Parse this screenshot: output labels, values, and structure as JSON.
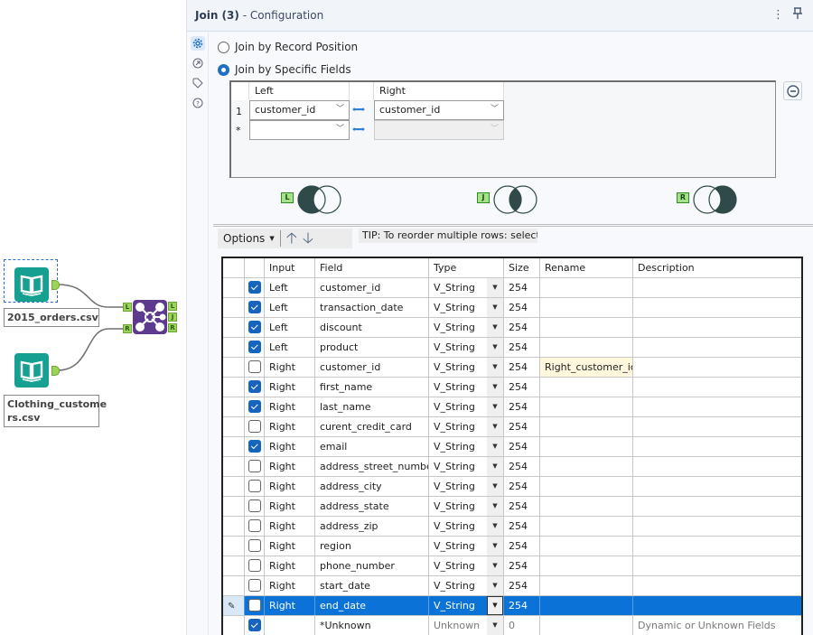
{
  "canvas": {
    "tools": [
      {
        "name": "2015_orders.csv",
        "label_lines": [
          "2015_orders.csv"
        ]
      },
      {
        "name": "Clothing_customers.csv",
        "label_lines": [
          "Clothing_custome",
          "rs.csv"
        ]
      }
    ],
    "join_tool": {
      "input_anchors": [
        "L",
        "R"
      ],
      "output_anchors": [
        "L",
        "J",
        "R"
      ]
    }
  },
  "panel": {
    "title_bold": "Join (3)",
    "title_rest": " - Configuration",
    "menu_icon": "⋮",
    "pin_icon": "pin-icon",
    "rail": [
      "gear-icon",
      "annotation-icon",
      "tag-icon",
      "help-icon"
    ]
  },
  "join_mode": {
    "options": [
      {
        "label": "Join by Record Position",
        "selected": false
      },
      {
        "label": "Join by Specific Fields",
        "selected": true
      }
    ]
  },
  "join_fields": {
    "headers": {
      "left": "Left",
      "right": "Right"
    },
    "rows": [
      {
        "index": "1",
        "left": "customer_id",
        "right": "customer_id"
      },
      {
        "index": "*",
        "left": "",
        "right": ""
      }
    ]
  },
  "venn": [
    {
      "anchor": "L",
      "name": "left-unjoined"
    },
    {
      "anchor": "J",
      "name": "inner-join"
    },
    {
      "anchor": "R",
      "name": "right-unjoined"
    }
  ],
  "toolbar": {
    "options_label": "Options",
    "tip": "TIP: To reorder multiple rows: select, right-click and drag."
  },
  "fields_table": {
    "headers": {
      "input": "Input",
      "field": "Field",
      "type": "Type",
      "size": "Size",
      "rename": "Rename",
      "description": "Description"
    },
    "rows": [
      {
        "checked": true,
        "input": "Left",
        "field": "customer_id",
        "type": "V_String",
        "size": "254",
        "rename": "",
        "description": ""
      },
      {
        "checked": true,
        "input": "Left",
        "field": "transaction_date",
        "type": "V_String",
        "size": "254",
        "rename": "",
        "description": ""
      },
      {
        "checked": true,
        "input": "Left",
        "field": "discount",
        "type": "V_String",
        "size": "254",
        "rename": "",
        "description": ""
      },
      {
        "checked": true,
        "input": "Left",
        "field": "product",
        "type": "V_String",
        "size": "254",
        "rename": "",
        "description": ""
      },
      {
        "checked": false,
        "input": "Right",
        "field": "customer_id",
        "type": "V_String",
        "size": "254",
        "rename": "Right_customer_id",
        "description": ""
      },
      {
        "checked": true,
        "input": "Right",
        "field": "first_name",
        "type": "V_String",
        "size": "254",
        "rename": "",
        "description": ""
      },
      {
        "checked": true,
        "input": "Right",
        "field": "last_name",
        "type": "V_String",
        "size": "254",
        "rename": "",
        "description": ""
      },
      {
        "checked": false,
        "input": "Right",
        "field": "curent_credit_card",
        "type": "V_String",
        "size": "254",
        "rename": "",
        "description": ""
      },
      {
        "checked": true,
        "input": "Right",
        "field": "email",
        "type": "V_String",
        "size": "254",
        "rename": "",
        "description": ""
      },
      {
        "checked": false,
        "input": "Right",
        "field": "address_street_number",
        "type": "V_String",
        "size": "254",
        "rename": "",
        "description": ""
      },
      {
        "checked": false,
        "input": "Right",
        "field": "address_city",
        "type": "V_String",
        "size": "254",
        "rename": "",
        "description": ""
      },
      {
        "checked": false,
        "input": "Right",
        "field": "address_state",
        "type": "V_String",
        "size": "254",
        "rename": "",
        "description": ""
      },
      {
        "checked": false,
        "input": "Right",
        "field": "address_zip",
        "type": "V_String",
        "size": "254",
        "rename": "",
        "description": ""
      },
      {
        "checked": false,
        "input": "Right",
        "field": "region",
        "type": "V_String",
        "size": "254",
        "rename": "",
        "description": ""
      },
      {
        "checked": false,
        "input": "Right",
        "field": "phone_number",
        "type": "V_String",
        "size": "254",
        "rename": "",
        "description": ""
      },
      {
        "checked": false,
        "input": "Right",
        "field": "start_date",
        "type": "V_String",
        "size": "254",
        "rename": "",
        "description": ""
      },
      {
        "checked": false,
        "input": "Right",
        "field": "end_date",
        "type": "V_String",
        "size": "254",
        "rename": "",
        "description": "",
        "selected": true
      },
      {
        "checked": true,
        "input": "",
        "field": "*Unknown",
        "type": "Unknown",
        "size": "0",
        "rename": "",
        "description": "Dynamic or Unknown Fields",
        "unknown": true
      }
    ]
  },
  "colors": {
    "accent": "#1565c0",
    "selected_row": "#0b73d7",
    "input_tool": "#15a091",
    "join_tool": "#5d3a8e",
    "anchor": "#9bd35b",
    "venn_fill": "#2f4a48"
  }
}
